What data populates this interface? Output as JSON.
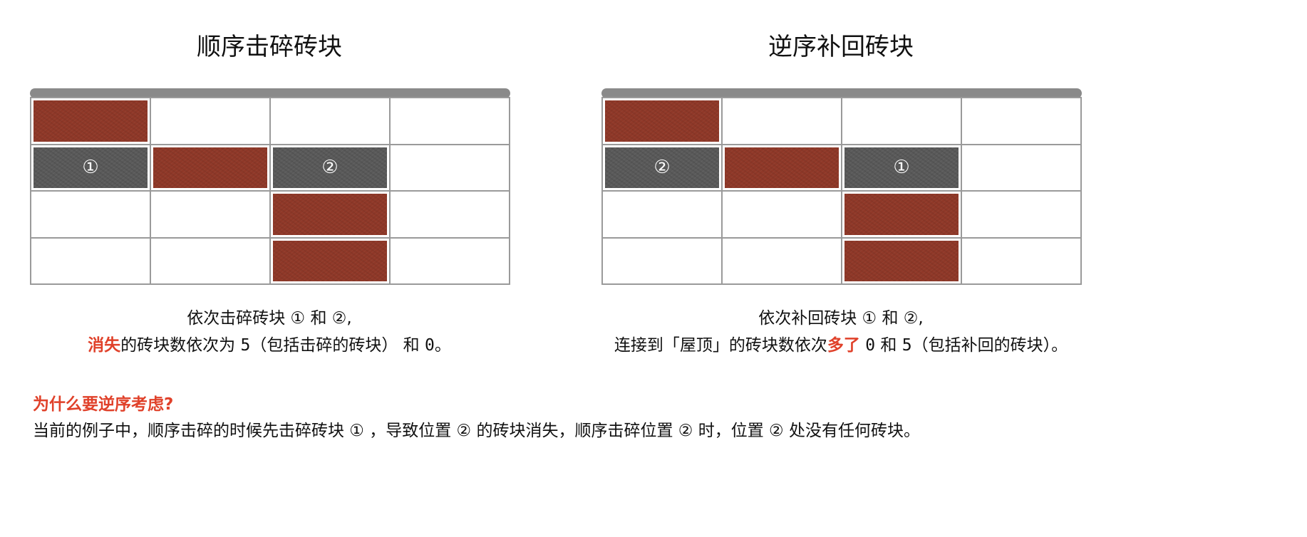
{
  "panels": [
    {
      "title": "顺序击碎砖块",
      "grid": {
        "rows": 4,
        "cols": 4,
        "bricks": [
          {
            "row": 0,
            "col": 0,
            "type": "red",
            "label": ""
          },
          {
            "row": 1,
            "col": 0,
            "type": "gray",
            "label": "①"
          },
          {
            "row": 1,
            "col": 1,
            "type": "red",
            "label": ""
          },
          {
            "row": 1,
            "col": 2,
            "type": "gray",
            "label": "②"
          },
          {
            "row": 2,
            "col": 2,
            "type": "red",
            "label": ""
          },
          {
            "row": 3,
            "col": 2,
            "type": "red",
            "label": ""
          }
        ]
      },
      "caption": {
        "line1": "依次击碎砖块 ① 和 ②,",
        "line2_highlight": "消失",
        "line2_a": "的砖块数依次为 ",
        "line2_num1": "5",
        "line2_b": "（包括击碎的砖块） 和 ",
        "line2_num2": "0",
        "line2_c": "。"
      }
    },
    {
      "title": "逆序补回砖块",
      "grid": {
        "rows": 4,
        "cols": 4,
        "bricks": [
          {
            "row": 0,
            "col": 0,
            "type": "red",
            "label": ""
          },
          {
            "row": 1,
            "col": 0,
            "type": "gray",
            "label": "②"
          },
          {
            "row": 1,
            "col": 1,
            "type": "red",
            "label": ""
          },
          {
            "row": 1,
            "col": 2,
            "type": "gray",
            "label": "①"
          },
          {
            "row": 2,
            "col": 2,
            "type": "red",
            "label": ""
          },
          {
            "row": 3,
            "col": 2,
            "type": "red",
            "label": ""
          }
        ]
      },
      "caption": {
        "line1": "依次补回砖块 ① 和 ②,",
        "line2_a": "连接到「屋顶」的砖块数依次",
        "line2_highlight": "多了",
        "line2_num1": "0",
        "line2_b": "和",
        "line2_num2": "5",
        "line2_c": "（包括补回的砖块）。"
      }
    }
  ],
  "question": "为什么要逆序考虑?",
  "explanation": "当前的例子中，顺序击碎的时候先击碎砖块 ① ，导致位置 ② 的砖块消失，顺序击碎位置 ② 时，位置 ②  处没有任何砖块。",
  "colors": {
    "brick_red": "#8f3828",
    "brick_gray": "#5a5a5a",
    "roof": "#8a8a8a",
    "grid_line": "#9a9a9a",
    "highlight": "#e0412a"
  }
}
